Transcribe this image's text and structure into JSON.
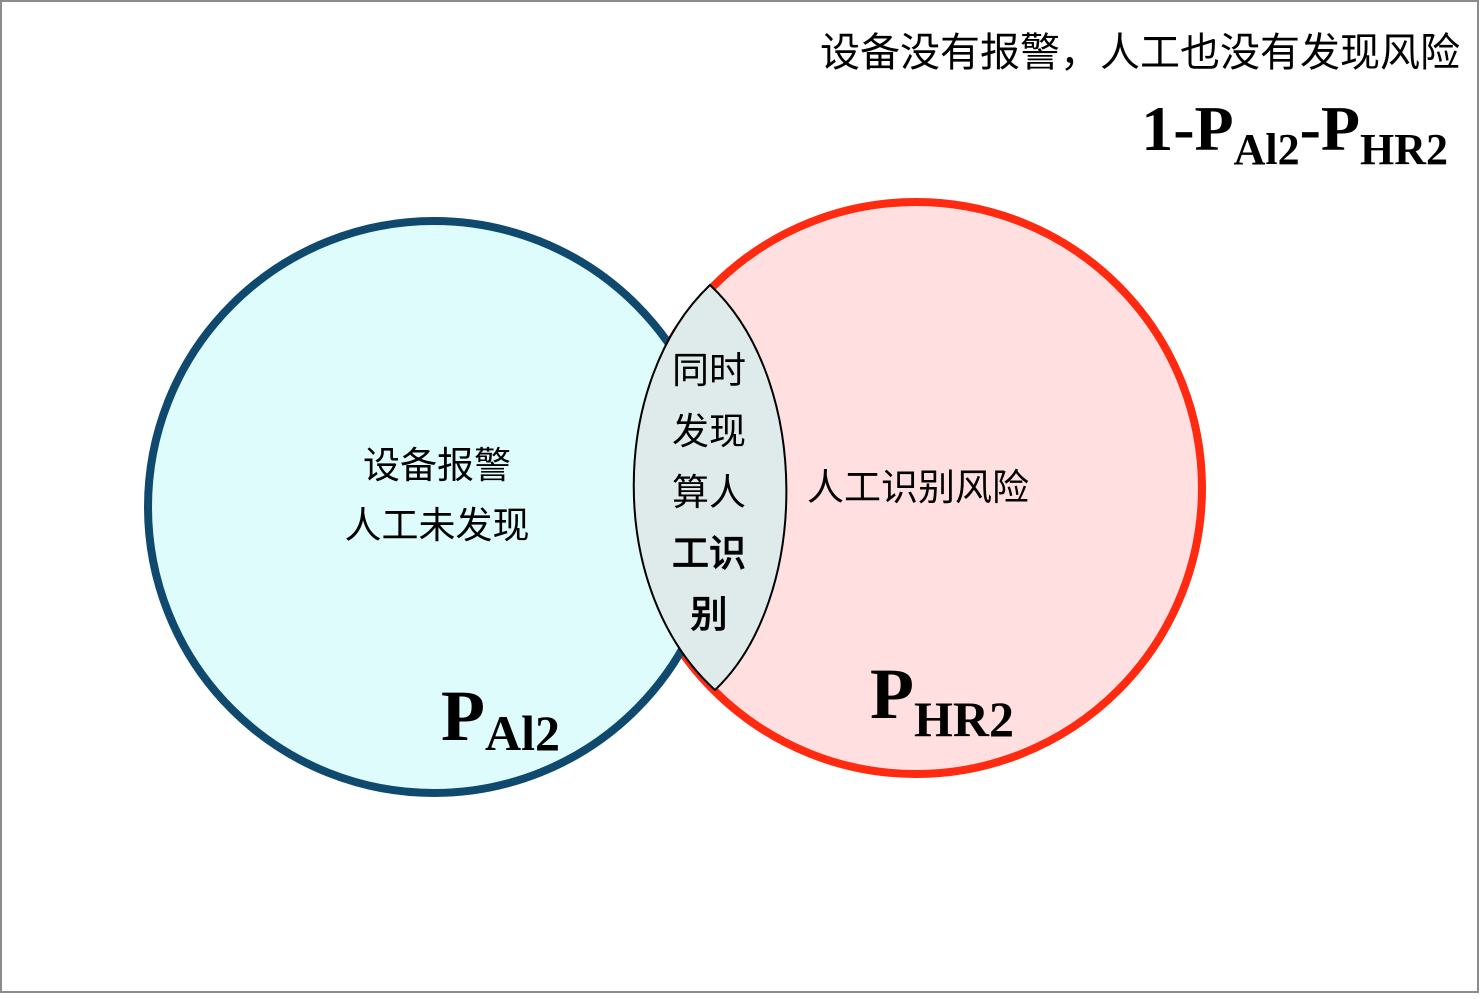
{
  "top_caption": "设备没有报警，人工也没有发现风险",
  "formula": {
    "lead": "1-P",
    "sub1": "Al2",
    "mid": "-P",
    "sub2": "HR2"
  },
  "left_circle": {
    "line1": "设备报警",
    "line2": "人工未发现",
    "symbol": "P",
    "symbol_sub": "Al2",
    "fill": "#dffcfc",
    "stroke": "#0f4a6e"
  },
  "right_circle": {
    "label": "人工识别风险",
    "symbol": "P",
    "symbol_sub": "HR2",
    "fill": "#ffdfe0",
    "stroke": "#ff2a10"
  },
  "overlap": {
    "lines": [
      "同时",
      "发现",
      "算人",
      "工识",
      "别"
    ],
    "fill": "#dfeaea"
  }
}
